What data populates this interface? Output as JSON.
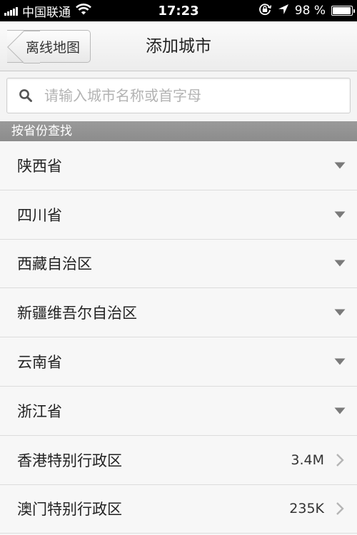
{
  "status_bar": {
    "carrier": "中国联通",
    "time": "17:23",
    "battery_percent": "98 %",
    "battery_level": 0.98
  },
  "nav": {
    "back_label": "离线地图",
    "title": "添加城市"
  },
  "search": {
    "placeholder": "请输入城市名称或首字母",
    "value": ""
  },
  "section": {
    "title": "按省份查找"
  },
  "provinces": [
    {
      "label": "陕西省",
      "indicator": "dropdown-triangle-icon"
    },
    {
      "label": "四川省",
      "indicator": "dropdown-triangle-icon"
    },
    {
      "label": "西藏自治区",
      "indicator": "dropdown-triangle-icon"
    },
    {
      "label": "新疆维吾尔自治区",
      "indicator": "dropdown-triangle-icon"
    },
    {
      "label": "云南省",
      "indicator": "dropdown-triangle-icon"
    },
    {
      "label": "浙江省",
      "indicator": "dropdown-triangle-icon"
    },
    {
      "label": "香港特别行政区",
      "size": "3.4M",
      "indicator": "chevron-right-icon"
    },
    {
      "label": "澳门特别行政区",
      "size": "235K",
      "indicator": "chevron-right-icon"
    }
  ],
  "colors": {
    "status_bar": "#000000",
    "section_header": "#929292",
    "list_background": "#f7f7f7",
    "divider": "#dcdcdc",
    "indicator": "#7a7a7a"
  }
}
